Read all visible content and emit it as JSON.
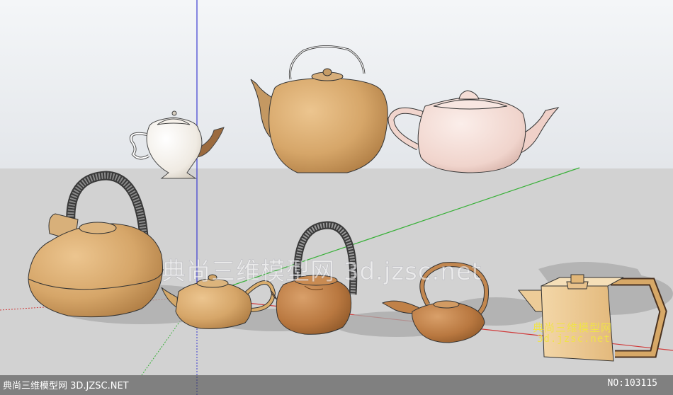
{
  "watermark": {
    "center": "典尚三维模型网 3d.jzsc.net",
    "right_line1": "典尚三维模型网",
    "right_line2": "3d.jzsc.net"
  },
  "footer": {
    "left": "典尚三维模型网 3D.JZSC.NET",
    "right": "NO:103115"
  },
  "colors": {
    "sky": "#e9ecef",
    "ground": "#d3d3d3",
    "axis_blue": "#3b3bd0",
    "axis_green": "#37b037",
    "axis_red": "#d03b3b",
    "clay": "#d9a86b",
    "terracotta": "#c88a4f",
    "cream": "#f1ebe3",
    "pink": "#f2d8d2"
  },
  "objects": [
    "white-teapot-with-brown-spout",
    "round-clay-teapot-with-wire-handle",
    "pink-utah-teapot",
    "large-kettle-with-woven-handle",
    "small-clay-teapot",
    "copper-teapot-with-woven-handle",
    "oil-lamp-style-teapot",
    "square-angular-teapot"
  ]
}
